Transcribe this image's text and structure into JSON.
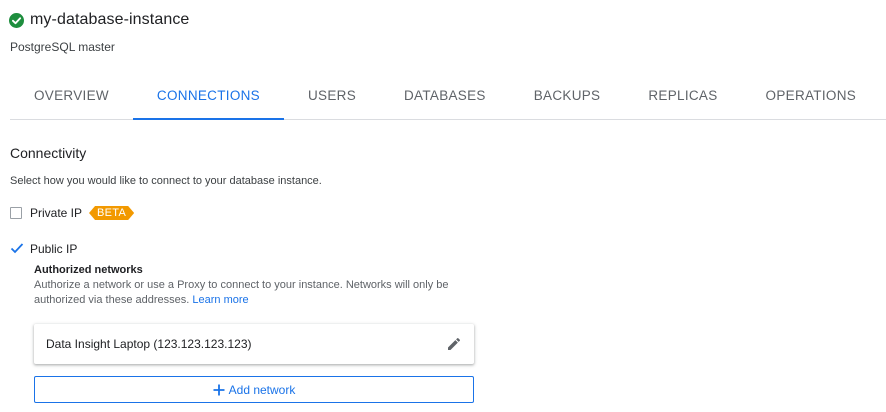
{
  "header": {
    "title": "my-database-instance",
    "subtitle": "PostgreSQL master",
    "status_icon": "check-circle-icon",
    "status_color": "#1e8e3e"
  },
  "tabs": [
    {
      "label": "OVERVIEW",
      "active": false
    },
    {
      "label": "CONNECTIONS",
      "active": true
    },
    {
      "label": "USERS",
      "active": false
    },
    {
      "label": "DATABASES",
      "active": false
    },
    {
      "label": "BACKUPS",
      "active": false
    },
    {
      "label": "REPLICAS",
      "active": false
    },
    {
      "label": "OPERATIONS",
      "active": false
    }
  ],
  "connectivity": {
    "title": "Connectivity",
    "description": "Select how you would like to connect to your database instance.",
    "private_ip": {
      "label": "Private IP",
      "checked": false,
      "badge": "BETA",
      "badge_color": "#f29900"
    },
    "public_ip": {
      "label": "Public IP",
      "checked": true
    },
    "authorized_networks": {
      "title": "Authorized networks",
      "description": "Authorize a network or use a Proxy to connect to your instance. Networks will only be authorized via these addresses.",
      "link": "Learn more",
      "networks": [
        {
          "name": "Data Insight Laptop (123.123.123.123)",
          "action_icon": "edit-icon"
        }
      ],
      "add_button": "Add network"
    }
  },
  "colors": {
    "accent": "#1a73e8",
    "text": "#202124",
    "muted": "#5f6368"
  }
}
